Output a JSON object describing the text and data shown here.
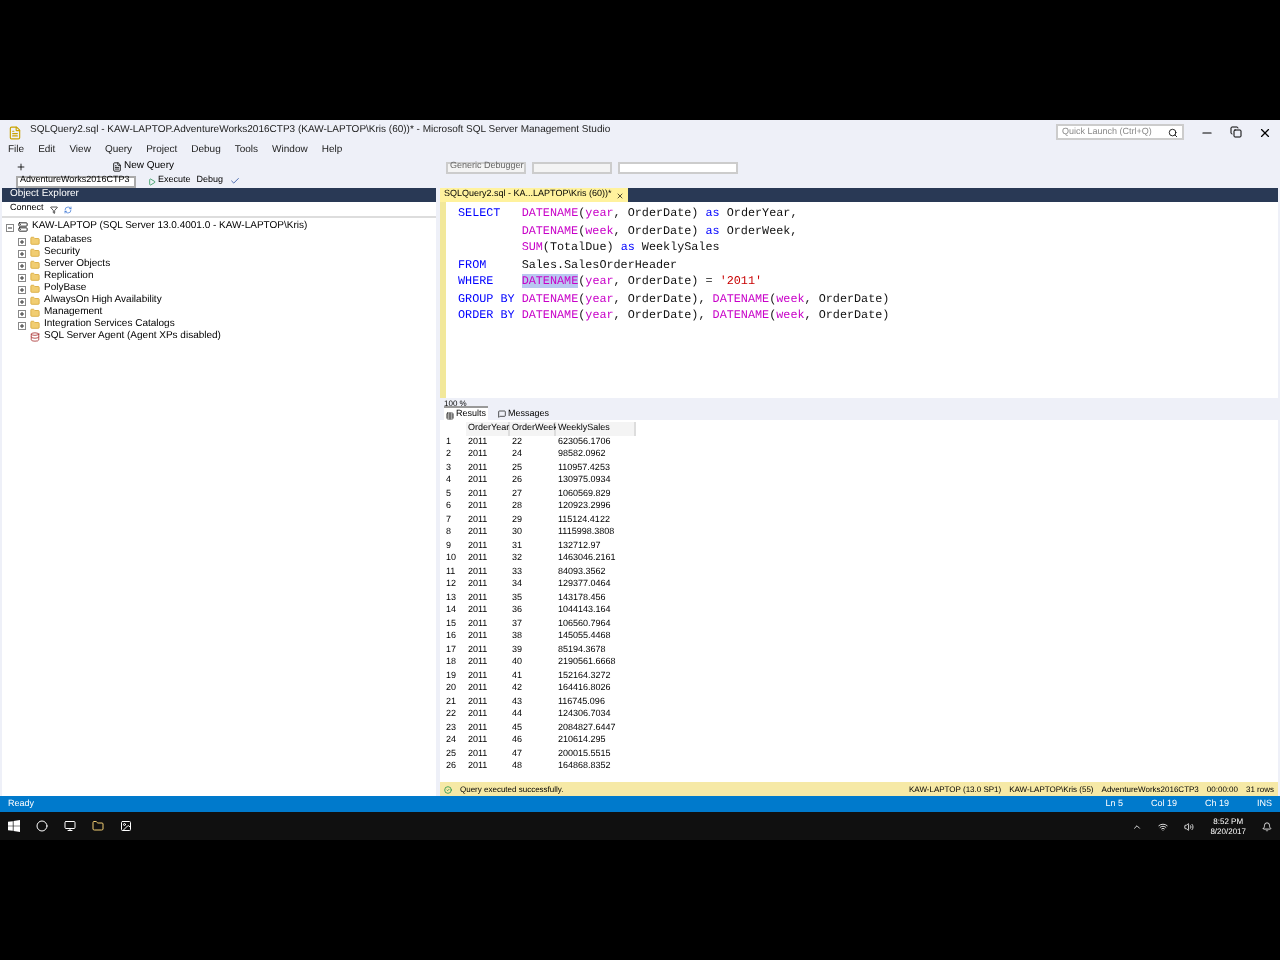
{
  "window": {
    "title": "SQLQuery2.sql - KAW-LAPTOP.AdventureWorks2016CTP3 (KAW-LAPTOP\\Kris (60))* - Microsoft SQL Server Management Studio",
    "quick_launch": {
      "placeholder": "Quick Launch (Ctrl+Q)"
    }
  },
  "menu": [
    "File",
    "Edit",
    "View",
    "Query",
    "Project",
    "Debug",
    "Tools",
    "Window",
    "Help"
  ],
  "toolbar": {
    "new_query": "New Query",
    "debugger": "Generic Debugger",
    "database": "AdventureWorks2016CTP3",
    "execute": "Execute",
    "debug": "Debug"
  },
  "object_explorer": {
    "title": "Object Explorer",
    "connect": "Connect",
    "server": "KAW-LAPTOP (SQL Server 13.0.4001.0 - KAW-LAPTOP\\Kris)",
    "expanded": true,
    "children": [
      {
        "label": "Databases",
        "kind": "folder"
      },
      {
        "label": "Security",
        "kind": "folder"
      },
      {
        "label": "Server Objects",
        "kind": "folder"
      },
      {
        "label": "Replication",
        "kind": "folder"
      },
      {
        "label": "PolyBase",
        "kind": "folder"
      },
      {
        "label": "AlwaysOn High Availability",
        "kind": "folder"
      },
      {
        "label": "Management",
        "kind": "folder"
      },
      {
        "label": "Integration Services Catalogs",
        "kind": "folder"
      },
      {
        "label": "SQL Server Agent (Agent XPs disabled)",
        "kind": "agent"
      }
    ]
  },
  "editor": {
    "tab": "SQLQuery2.sql - KA...LAPTOP\\Kris (60))*",
    "zoom": "100 %",
    "lines": [
      {
        "indent": false,
        "tokens": [
          {
            "t": "SELECT   ",
            "kind": "keyword"
          },
          {
            "t": "DATENAME",
            "kind": "function"
          },
          {
            "t": "(",
            "kind": "plain"
          },
          {
            "t": "year",
            "kind": "function"
          },
          {
            "t": ", OrderDate) ",
            "kind": "plain"
          },
          {
            "t": "as",
            "kind": "keyword"
          },
          {
            "t": " OrderYear,",
            "kind": "plain"
          }
        ]
      },
      {
        "indent": true,
        "tokens": [
          {
            "t": "DATENAME",
            "kind": "function"
          },
          {
            "t": "(",
            "kind": "plain"
          },
          {
            "t": "week",
            "kind": "function"
          },
          {
            "t": ", OrderDate) ",
            "kind": "plain"
          },
          {
            "t": "as",
            "kind": "keyword"
          },
          {
            "t": " OrderWeek,",
            "kind": "plain"
          }
        ]
      },
      {
        "indent": true,
        "tokens": [
          {
            "t": "SUM",
            "kind": "function"
          },
          {
            "t": "(TotalDue) ",
            "kind": "plain"
          },
          {
            "t": "as",
            "kind": "keyword"
          },
          {
            "t": " WeeklySales",
            "kind": "plain"
          }
        ]
      },
      {
        "indent": false,
        "tokens": [
          {
            "t": "FROM",
            "kind": "keyword"
          },
          {
            "t": "     Sales.SalesOrderHeader",
            "kind": "plain"
          }
        ]
      },
      {
        "indent": false,
        "tokens": [
          {
            "t": "WHERE    ",
            "kind": "keyword"
          },
          {
            "t": "DATENAME",
            "kind": "highlight"
          },
          {
            "t": "(",
            "kind": "plain"
          },
          {
            "t": "year",
            "kind": "function"
          },
          {
            "t": ", OrderDate) = ",
            "kind": "plain"
          },
          {
            "t": "'2011'",
            "kind": "string"
          }
        ]
      },
      {
        "indent": false,
        "tokens": [
          {
            "t": "GROUP BY ",
            "kind": "keyword"
          },
          {
            "t": "DATENAME",
            "kind": "function"
          },
          {
            "t": "(",
            "kind": "plain"
          },
          {
            "t": "year",
            "kind": "function"
          },
          {
            "t": ", OrderDate), ",
            "kind": "plain"
          },
          {
            "t": "DATENAME",
            "kind": "function"
          },
          {
            "t": "(",
            "kind": "plain"
          },
          {
            "t": "week",
            "kind": "function"
          },
          {
            "t": ", OrderDate)",
            "kind": "plain"
          }
        ]
      },
      {
        "indent": false,
        "tokens": [
          {
            "t": "ORDER BY ",
            "kind": "keyword"
          },
          {
            "t": "DATENAME",
            "kind": "function"
          },
          {
            "t": "(",
            "kind": "plain"
          },
          {
            "t": "year",
            "kind": "function"
          },
          {
            "t": ", OrderDate), ",
            "kind": "plain"
          },
          {
            "t": "DATENAME",
            "kind": "function"
          },
          {
            "t": "(",
            "kind": "plain"
          },
          {
            "t": "week",
            "kind": "function"
          },
          {
            "t": ", OrderDate)",
            "kind": "plain"
          }
        ]
      }
    ]
  },
  "results": {
    "tabs": [
      {
        "label": "Results",
        "selected": true
      },
      {
        "label": "Messages",
        "selected": false
      }
    ],
    "columns": [
      "OrderYear",
      "OrderWeek",
      "WeeklySales"
    ],
    "rows": [
      {
        "n": "1",
        "cells": [
          "2011",
          "22",
          "623056.1706"
        ]
      },
      {
        "n": "2",
        "cells": [
          "2011",
          "24",
          "98582.0962"
        ]
      },
      {
        "n": "3",
        "cells": [
          "2011",
          "25",
          "110957.4253"
        ]
      },
      {
        "n": "4",
        "cells": [
          "2011",
          "26",
          "130975.0934"
        ]
      },
      {
        "n": "5",
        "cells": [
          "2011",
          "27",
          "1060569.829"
        ]
      },
      {
        "n": "6",
        "cells": [
          "2011",
          "28",
          "120923.2996"
        ]
      },
      {
        "n": "7",
        "cells": [
          "2011",
          "29",
          "115124.4122"
        ]
      },
      {
        "n": "8",
        "cells": [
          "2011",
          "30",
          "1115998.3808"
        ]
      },
      {
        "n": "9",
        "cells": [
          "2011",
          "31",
          "132712.97"
        ]
      },
      {
        "n": "10",
        "cells": [
          "2011",
          "32",
          "1463046.2161"
        ]
      },
      {
        "n": "11",
        "cells": [
          "2011",
          "33",
          "84093.3562"
        ]
      },
      {
        "n": "12",
        "cells": [
          "2011",
          "34",
          "129377.0464"
        ]
      },
      {
        "n": "13",
        "cells": [
          "2011",
          "35",
          "143178.456"
        ]
      },
      {
        "n": "14",
        "cells": [
          "2011",
          "36",
          "1044143.164"
        ]
      },
      {
        "n": "15",
        "cells": [
          "2011",
          "37",
          "106560.7964"
        ]
      },
      {
        "n": "16",
        "cells": [
          "2011",
          "38",
          "145055.4468"
        ]
      },
      {
        "n": "17",
        "cells": [
          "2011",
          "39",
          "85194.3678"
        ]
      },
      {
        "n": "18",
        "cells": [
          "2011",
          "40",
          "2190561.6668"
        ]
      },
      {
        "n": "19",
        "cells": [
          "2011",
          "41",
          "152164.3272"
        ]
      },
      {
        "n": "20",
        "cells": [
          "2011",
          "42",
          "164416.8026"
        ]
      },
      {
        "n": "21",
        "cells": [
          "2011",
          "43",
          "116745.096"
        ]
      },
      {
        "n": "22",
        "cells": [
          "2011",
          "44",
          "124306.7034"
        ]
      },
      {
        "n": "23",
        "cells": [
          "2011",
          "45",
          "2084827.6447"
        ]
      },
      {
        "n": "24",
        "cells": [
          "2011",
          "46",
          "210614.295"
        ]
      },
      {
        "n": "25",
        "cells": [
          "2011",
          "47",
          "200015.5515"
        ]
      },
      {
        "n": "26",
        "cells": [
          "2011",
          "48",
          "164868.8352"
        ]
      }
    ]
  },
  "query_status": {
    "message": "Query executed successfully.",
    "server": "KAW-LAPTOP (13.0 SP1)",
    "user": "KAW-LAPTOP\\Kris (55)",
    "database": "AdventureWorks2016CTP3",
    "elapsed": "00:00:00",
    "rows": "31 rows"
  },
  "status_bar": {
    "state": "Ready",
    "line": "Ln 5",
    "col": "Col 19",
    "ch": "Ch 19",
    "mode": "INS"
  },
  "taskbar": {
    "time": "8:52 PM",
    "date": "8/20/2017"
  }
}
